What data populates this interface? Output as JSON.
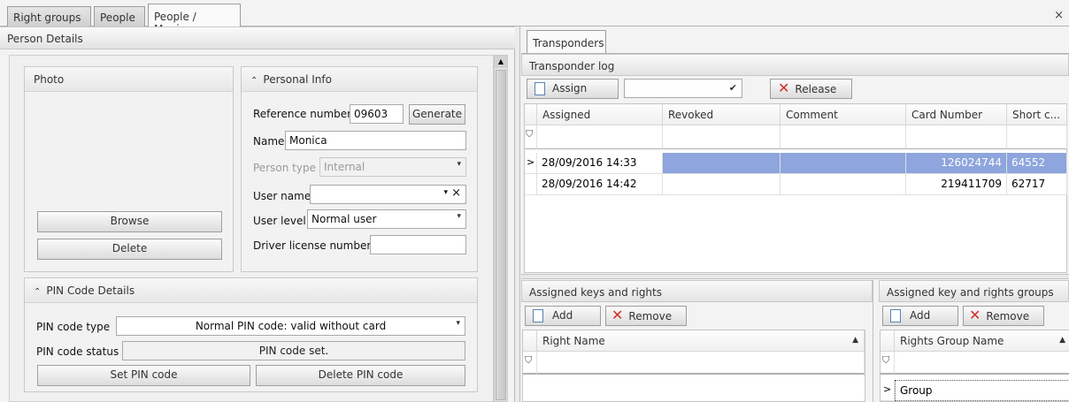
{
  "tabs": [
    {
      "label": "Right groups"
    },
    {
      "label": "People"
    },
    {
      "label": "People / Monica"
    }
  ],
  "close_glyph": "×",
  "person_details": {
    "title": "Person Details",
    "photo": {
      "title": "Photo",
      "browse_label": "Browse",
      "delete_label": "Delete"
    },
    "personal_info": {
      "title": "Personal Info",
      "reference_label": "Reference number",
      "reference_value": "09603",
      "generate_label": "Generate",
      "name_label": "Name",
      "name_value": "Monica",
      "person_type_label": "Person type",
      "person_type_value": "Internal",
      "username_label": "User name",
      "username_value": "",
      "user_level_label": "User level",
      "user_level_value": "Normal user",
      "driver_license_label": "Driver license number:",
      "driver_license_value": ""
    },
    "pin": {
      "title": "PIN Code Details",
      "type_label": "PIN code type",
      "type_value": "Normal PIN code: valid without card",
      "status_label": "PIN code status",
      "status_value": "PIN code set.",
      "set_label": "Set PIN code",
      "delete_label": "Delete PIN code"
    }
  },
  "transponders": {
    "tab_label": "Transponders",
    "log_title": "Transponder log",
    "assign_label": "Assign",
    "assign_combo_value": "",
    "release_label": "Release",
    "columns": [
      "Assigned",
      "Revoked",
      "Comment",
      "Card Number",
      "Short c..."
    ],
    "rows": [
      {
        "assigned": "28/09/2016 14:33",
        "revoked": "",
        "comment": "",
        "card": "126024744",
        "short": "64552"
      },
      {
        "assigned": "28/09/2016 14:42",
        "revoked": "",
        "comment": "",
        "card": "219411709",
        "short": "62717"
      }
    ]
  },
  "keys_rights": {
    "title": "Assigned keys and rights",
    "add_label": "Add",
    "remove_label": "Remove",
    "column": "Right Name"
  },
  "rights_groups": {
    "title": "Assigned key and rights groups",
    "add_label": "Add",
    "remove_label": "Remove",
    "column": "Rights Group Name",
    "rows": [
      "Group"
    ]
  },
  "colors": {
    "selection": "#8ea5dd",
    "remove_x": "#d0302a"
  }
}
